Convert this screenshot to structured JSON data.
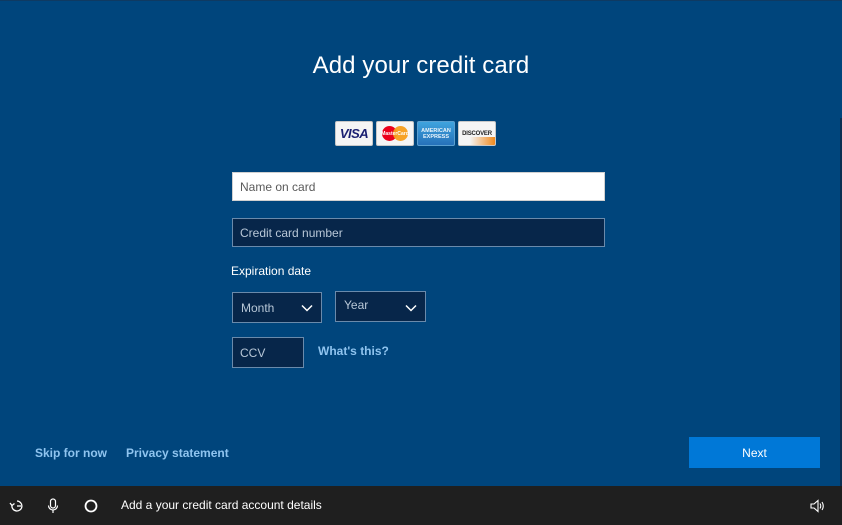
{
  "title": "Add your credit card",
  "card_logos": {
    "visa": "VISA",
    "mastercard": "MasterCard",
    "amex": "AMERICAN EXPRESS",
    "discover": "DISCOVER"
  },
  "form": {
    "name_placeholder": "Name on card",
    "number_placeholder": "Credit card number",
    "expiration_label": "Expiration date",
    "month_value": "Month",
    "year_value": "Year",
    "ccv_placeholder": "CCV",
    "whats_this": "What's this?"
  },
  "footer": {
    "skip": "Skip for now",
    "privacy": "Privacy statement",
    "next": "Next"
  },
  "taskbar": {
    "status_text": "Add a your credit card account details",
    "icons": [
      "ease-of-access-icon",
      "microphone-icon",
      "cortana-icon",
      "volume-icon"
    ]
  },
  "colors": {
    "background": "#00457c",
    "accent": "#0078d7",
    "link": "#8fc4ef",
    "taskbar": "#1f1f1f"
  }
}
